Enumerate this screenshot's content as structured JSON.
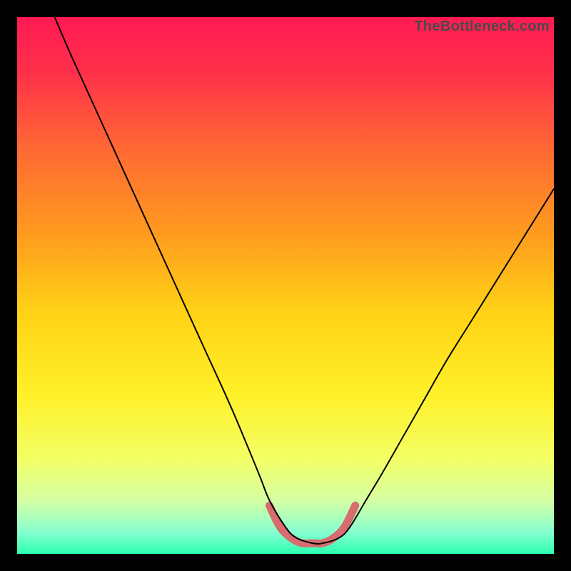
{
  "watermark": "TheBottleneck.com",
  "chart_data": {
    "type": "line",
    "title": "",
    "xlabel": "",
    "ylabel": "",
    "xlim": [
      0,
      100
    ],
    "ylim": [
      0,
      100
    ],
    "grid": false,
    "background_gradient_stops": [
      {
        "offset": 0.0,
        "color": "#ff1a53"
      },
      {
        "offset": 0.1,
        "color": "#ff2f4a"
      },
      {
        "offset": 0.25,
        "color": "#ff6a33"
      },
      {
        "offset": 0.4,
        "color": "#ff9a1f"
      },
      {
        "offset": 0.55,
        "color": "#ffd215"
      },
      {
        "offset": 0.7,
        "color": "#fff028"
      },
      {
        "offset": 0.82,
        "color": "#f4ff63"
      },
      {
        "offset": 0.9,
        "color": "#d6ffa3"
      },
      {
        "offset": 0.96,
        "color": "#86ffd0"
      },
      {
        "offset": 1.0,
        "color": "#2bffb0"
      }
    ],
    "series": [
      {
        "name": "bottleneck-curve",
        "x": [
          7,
          10,
          15,
          20,
          25,
          30,
          35,
          40,
          45,
          47,
          50,
          52,
          55,
          57,
          60,
          62,
          65,
          68,
          72,
          76,
          80,
          85,
          90,
          95,
          100
        ],
        "y": [
          100,
          93,
          82,
          71,
          60,
          49,
          38,
          27,
          15,
          10,
          5,
          3,
          2,
          2,
          3,
          5,
          10,
          15,
          22,
          29,
          36,
          44,
          52,
          60,
          68
        ]
      }
    ],
    "valley_highlight": {
      "name": "optimal-range",
      "color": "#d76d6e",
      "x": [
        47,
        49,
        51,
        53,
        55,
        57,
        59,
        61,
        63
      ],
      "y": [
        9,
        5,
        3,
        2,
        2,
        2,
        3,
        5,
        9
      ]
    }
  }
}
